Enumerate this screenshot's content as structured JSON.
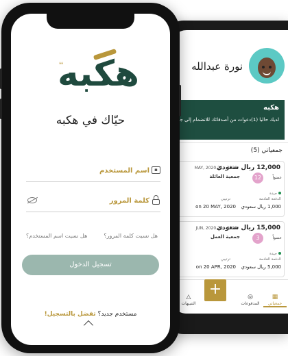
{
  "login": {
    "logo_text": "هكبه",
    "welcome": "حيّاك في هكبه",
    "username_label": "اسم المستخدم",
    "password_label": "كلمة المرور",
    "forgot_password": "هل نسيت كلمة المرور؟",
    "forgot_username": "هل نسيت اسم المستخدم؟",
    "login_button": "تسجيل الدخول",
    "new_user": "مستخدم جديد؟",
    "register_link": "تفضل بالتسجيل!"
  },
  "home": {
    "user_name": "نورة عبدالله",
    "banner_title": "هكبه",
    "banner_text": "لديك حاليا (1)دعوات من أصدقائك للانضمام إلى جمعيات",
    "groups_title": "جمعياتي (5)",
    "groups": [
      {
        "amount": "12,000 ريال سعودي",
        "dates": "2020 - 21 MAY, 2020",
        "name": "جمعية العائلة",
        "members_count": "12",
        "members_label": "عضواً",
        "status": "جيدة",
        "next_payment_label": "الدفعة القادمة",
        "next_payment_value": "1,000 ريال سعودي",
        "order_label": "ترتيبي",
        "order_value": "on 20 MAY, 2020"
      },
      {
        "amount": "15,000 ريال سعودي",
        "dates": "2020 - 20 JUN, 2020",
        "name": "جمعية العمل",
        "members_count": "3",
        "members_label": "عضواً",
        "status": "جيدة",
        "next_payment_label": "الدفعة القادمة",
        "next_payment_value": "5,000 ريال سعودي",
        "order_label": "ترتيبي",
        "order_value": "on 20 APR, 2020"
      }
    ],
    "tabs": {
      "groups": "جمعياتي",
      "payments": "المدفوعات",
      "notifications": "التنبيهات"
    },
    "fab": "+"
  },
  "colors": {
    "brand_green": "#1f4a3e",
    "brand_gold": "#b9973b",
    "button_disabled": "#9bb7ae",
    "badge_pink": "#e3a3cb"
  }
}
